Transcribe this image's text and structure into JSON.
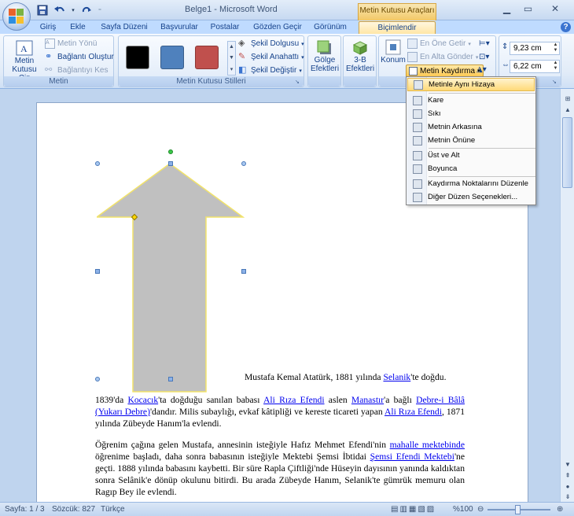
{
  "window": {
    "title": "Belge1 - Microsoft Word",
    "context_tab_header": "Metin Kutusu Araçları"
  },
  "qat": [
    "save-icon",
    "undo-icon",
    "redo-icon",
    "customize-icon"
  ],
  "tabs": [
    "Giriş",
    "Ekle",
    "Sayfa Düzeni",
    "Başvurular",
    "Postalar",
    "Gözden Geçir",
    "Görünüm",
    "Biçimlendir"
  ],
  "active_tab": "Biçimlendir",
  "ribbon": {
    "metin": {
      "label": "Metin",
      "draw_textbox": "Metin Kutusu Çiz",
      "text_direction": "Metin Yönü",
      "create_link": "Bağlantı Oluştur",
      "break_link": "Bağlantıyı Kes"
    },
    "styles": {
      "label": "Metin Kutusu Stilleri",
      "swatches": [
        "#000000",
        "#4f81bd",
        "#c0504d"
      ],
      "shape_fill": "Şekil Dolgusu",
      "shape_outline": "Şekil Anahattı",
      "change_shape": "Şekil Değiştir"
    },
    "shadow": "Gölge Efektleri",
    "three_d": "3-B Efektleri",
    "arrange": {
      "position": "Konum",
      "bring_front": "En Öne Getir",
      "send_back": "En Alta Gönder",
      "text_wrap": "Metin Kaydırma"
    },
    "size": {
      "height": "9,23 cm",
      "width": "6,22 cm"
    }
  },
  "wrap_menu": {
    "items": [
      "Metinle Aynı Hizaya",
      "Kare",
      "Sıkı",
      "Metnin Arkasına",
      "Metnin Önüne",
      "Üst ve Alt",
      "Boyunca",
      "Kaydırma Noktalarını Düzenle",
      "Diğer Düzen Seçenekleri..."
    ],
    "highlighted": "Metinle Aynı Hizaya"
  },
  "document": {
    "para1_plain": "Mustafa Kemal Atatürk, 1881 yılında ",
    "para1_link": "Selanik",
    "para1_end": "'te doğdu.",
    "para2": {
      "t1": "1839'da ",
      "l1": "Kocacık",
      "t2": "'ta doğduğu sanılan babası ",
      "l2": "Ali Rıza Efendi",
      "t3": " aslen ",
      "l3": "Manastır",
      "t4": "'a bağlı ",
      "l4": "Debre-i Bâlâ (Yukarı Debre)",
      "t5": "'dandır. Milis subaylığı, evkaf kâtipliği ve kereste ticareti yapan ",
      "l5": "Ali Rıza Efendi",
      "t6": ", 1871 yılında Zübeyde Hanım'la evlendi."
    },
    "para3": {
      "t1": "Öğrenim çağına gelen Mustafa, annesinin isteğiyle Hafız Mehmet Efendi'nin ",
      "l1": "mahalle mektebinde",
      "t2": " öğrenime başladı, daha sonra babasının isteğiyle Mektebi Şemsi İbtidai ",
      "l2": "Şemsi Efendi Mektebi",
      "t3": "'ne geçti. 1888 yılında babasını kaybetti. Bir süre Rapla Çiftliği'nde Hüseyin dayısının yanında kaldıktan sonra Selânik'e dönüp okulunu bitirdi. Bu arada Zübeyde Hanım, Selanik'te gümrük memuru olan Ragıp Bey ile evlendi."
    }
  },
  "status": {
    "page": "Sayfa: 1 / 3",
    "words": "Sözcük: 827",
    "language": "Türkçe",
    "zoom": "%100"
  },
  "colors": {
    "arrow_fill": "#c0c0c0",
    "arrow_stroke": "#f2e36a",
    "menu_highlight": "#ffd977",
    "link": "#0000ee"
  }
}
